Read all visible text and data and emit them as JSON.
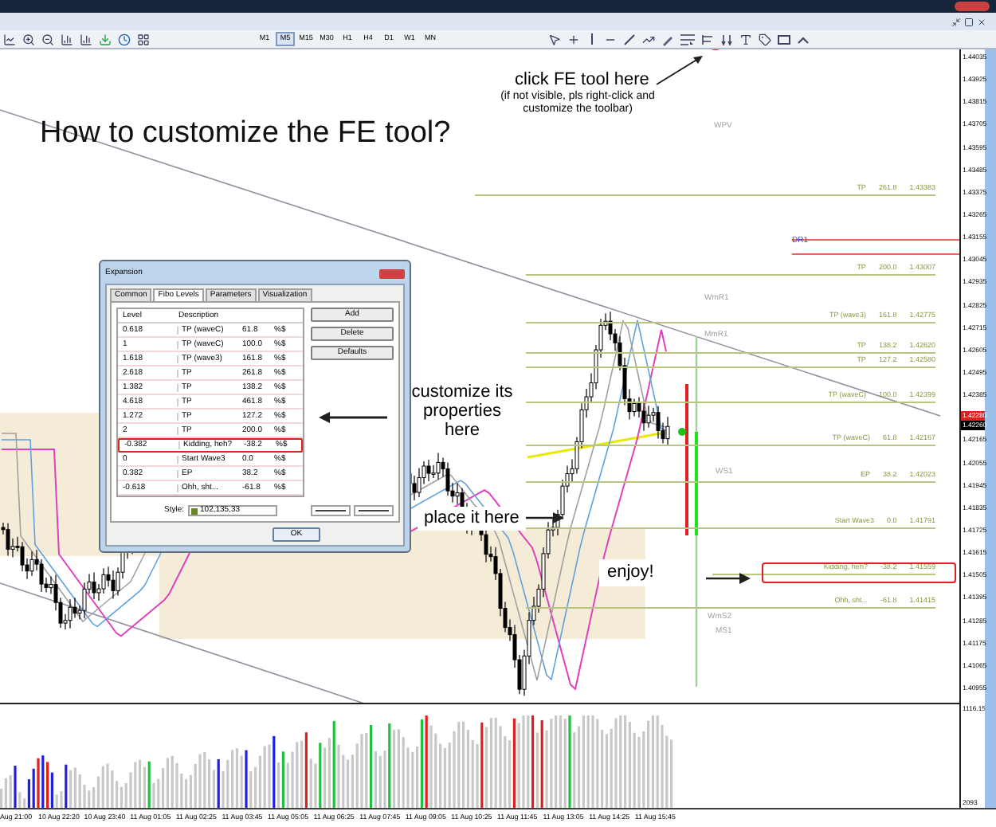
{
  "toolbar": {
    "timeframes": [
      {
        "label": "M1",
        "selected": false
      },
      {
        "label": "M5",
        "selected": true
      },
      {
        "label": "M15",
        "selected": false
      },
      {
        "label": "M30",
        "selected": false
      },
      {
        "label": "H1",
        "selected": false
      },
      {
        "label": "H4",
        "selected": false
      },
      {
        "label": "D1",
        "selected": false
      },
      {
        "label": "W1",
        "selected": false
      },
      {
        "label": "MN",
        "selected": false
      }
    ]
  },
  "annotations": {
    "title": "How to customize the FE tool?",
    "click_hint": "click FE tool here",
    "click_note": [
      "(if not visible, pls right-click and",
      "customize the toolbar)"
    ],
    "properties_hint": "customize its properties here",
    "place_hint": "place it here",
    "enjoy": "enjoy!"
  },
  "dialog": {
    "title": "Expansion",
    "tabs": [
      {
        "label": "Common",
        "selected": false
      },
      {
        "label": "Fibo Levels",
        "selected": true
      },
      {
        "label": "Parameters",
        "selected": false
      },
      {
        "label": "Visualization",
        "selected": false
      }
    ],
    "columns": [
      "Level",
      "Description"
    ],
    "rows": [
      {
        "level": "0.618",
        "description": "TP (waveC)",
        "ratio": "61.8",
        "format": "%$",
        "highlighted": false
      },
      {
        "level": "1",
        "description": "TP (waveC)",
        "ratio": "100.0",
        "format": "%$",
        "highlighted": false
      },
      {
        "level": "1.618",
        "description": "TP (wave3)",
        "ratio": "161.8",
        "format": "%$",
        "highlighted": false
      },
      {
        "level": "2.618",
        "description": "TP",
        "ratio": "261.8",
        "format": "%$",
        "highlighted": false
      },
      {
        "level": "1.382",
        "description": "TP",
        "ratio": "138.2",
        "format": "%$",
        "highlighted": false
      },
      {
        "level": "4.618",
        "description": "TP",
        "ratio": "461.8",
        "format": "%$",
        "highlighted": false
      },
      {
        "level": "1.272",
        "description": "TP",
        "ratio": "127.2",
        "format": "%$",
        "highlighted": false
      },
      {
        "level": "2",
        "description": "TP",
        "ratio": "200.0",
        "format": "%$",
        "highlighted": false
      },
      {
        "level": "-0.382",
        "description": "Kidding, heh?",
        "ratio": "-38.2",
        "format": "%$",
        "highlighted": true
      },
      {
        "level": "0",
        "description": "Start Wave3",
        "ratio": "0.0",
        "format": "%$",
        "highlighted": false
      },
      {
        "level": "0.382",
        "description": "EP",
        "ratio": "38.2",
        "format": "%$",
        "highlighted": false
      },
      {
        "level": "-0.618",
        "description": "Ohh, sht...",
        "ratio": "-61.8",
        "format": "%$",
        "highlighted": false
      }
    ],
    "buttons": [
      "Add",
      "Delete",
      "Defaults"
    ],
    "style_label": "Style:",
    "style_value": "102,135,33",
    "ok": "OK"
  },
  "chart": {
    "level_labels": [
      {
        "description": "TP",
        "ratio": "261.8",
        "price": "1.43383"
      },
      {
        "description": "TP",
        "ratio": "200.0",
        "price": "1.43007"
      },
      {
        "description": "TP (wave3)",
        "ratio": "161.8",
        "price": "1.42775"
      },
      {
        "description": "TP",
        "ratio": "138.2",
        "price": "1.42620"
      },
      {
        "description": "TP",
        "ratio": "127.2",
        "price": "1.42580"
      },
      {
        "description": "TP (waveC)",
        "ratio": "100.0",
        "price": "1.42399"
      },
      {
        "description": "TP (waveC)",
        "ratio": "61.8",
        "price": "1.42167"
      },
      {
        "description": "EP",
        "ratio": "38.2",
        "price": "1.42023"
      },
      {
        "description": "Start Wave3",
        "ratio": "0.0",
        "price": "1.41791"
      },
      {
        "description": "Kidding, heh?",
        "ratio": "-38.2",
        "price": "1.41559"
      },
      {
        "description": "Ohh, sht...",
        "ratio": "-61.8",
        "price": "1.41415"
      }
    ],
    "pivot_labels": [
      "WPV",
      "DR1",
      "WmR1",
      "MmR1",
      "WS1",
      "WmS2",
      "MS1"
    ],
    "price_axis": [
      "1.44035",
      "1.43925",
      "1.43815",
      "1.43705",
      "1.43595",
      "1.43485",
      "1.43375",
      "1.43265",
      "1.43155",
      "1.43045",
      "1.42935",
      "1.42825",
      "1.42715",
      "1.42605",
      "1.42495",
      "1.42385",
      "1.42165",
      "1.42055",
      "1.41945",
      "1.41835",
      "1.41725",
      "1.41615",
      "1.41505",
      "1.41395",
      "1.41285",
      "1.41175",
      "1.41065",
      "1.40955"
    ],
    "current_prices": [
      {
        "text": "1.42280",
        "color": "#e02020"
      },
      {
        "text": "1.42260",
        "color": "#000000"
      }
    ],
    "volume_axis": [
      "1116.15",
      "2093"
    ],
    "time_axis": [
      "Aug 21:00",
      "10 Aug 22:20",
      "10 Aug 23:40",
      "11 Aug 01:05",
      "11 Aug 02:25",
      "11 Aug 03:45",
      "11 Aug 05:05",
      "11 Aug 06:25",
      "11 Aug 07:45",
      "11 Aug 09:05",
      "11 Aug 10:25",
      "11 Aug 11:45",
      "11 Aug 13:05",
      "11 Aug 14:25",
      "11 Aug 15:45"
    ]
  }
}
